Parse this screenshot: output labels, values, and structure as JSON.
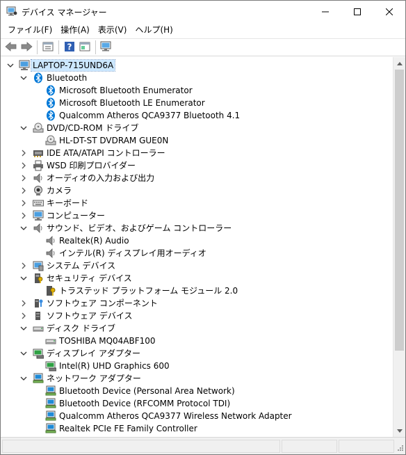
{
  "window": {
    "title": "デバイス マネージャー"
  },
  "menu": [
    {
      "label": "ファイル(F)"
    },
    {
      "label": "操作(A)"
    },
    {
      "label": "表示(V)"
    },
    {
      "label": "ヘルプ(H)"
    }
  ],
  "toolbar": {
    "buttons": [
      "back-icon",
      "forward-icon",
      "properties-icon",
      "help-icon",
      "view-icon",
      "scan-hardware-icon"
    ]
  },
  "tree": {
    "root": "LAPTOP-715UND6A",
    "nodes": [
      {
        "level": 1,
        "expanded": true,
        "icon": "bluetooth-icon",
        "label": "Bluetooth"
      },
      {
        "level": 2,
        "icon": "bluetooth-icon",
        "label": "Microsoft Bluetooth Enumerator"
      },
      {
        "level": 2,
        "icon": "bluetooth-icon",
        "label": "Microsoft Bluetooth LE Enumerator"
      },
      {
        "level": 2,
        "icon": "bluetooth-icon",
        "label": "Qualcomm Atheros QCA9377 Bluetooth 4.1"
      },
      {
        "level": 1,
        "expanded": true,
        "icon": "dvd-drive-icon",
        "label": "DVD/CD-ROM ドライブ"
      },
      {
        "level": 2,
        "icon": "dvd-drive-icon",
        "label": "HL-DT-ST DVDRAM GUE0N"
      },
      {
        "level": 1,
        "expanded": false,
        "icon": "ide-controller-icon",
        "label": "IDE ATA/ATAPI コントローラー"
      },
      {
        "level": 1,
        "expanded": false,
        "icon": "printer-icon",
        "label": "WSD 印刷プロバイダー"
      },
      {
        "level": 1,
        "expanded": false,
        "icon": "speaker-icon",
        "label": "オーディオの入力および出力"
      },
      {
        "level": 1,
        "expanded": false,
        "icon": "camera-icon",
        "label": "カメラ"
      },
      {
        "level": 1,
        "expanded": false,
        "icon": "keyboard-icon",
        "label": "キーボード"
      },
      {
        "level": 1,
        "expanded": false,
        "icon": "monitor-icon",
        "label": "コンピューター"
      },
      {
        "level": 1,
        "expanded": true,
        "icon": "speaker-icon",
        "label": "サウンド、ビデオ、およびゲーム コントローラー"
      },
      {
        "level": 2,
        "icon": "speaker-icon",
        "label": "Realtek(R) Audio"
      },
      {
        "level": 2,
        "icon": "speaker-icon",
        "label": "インテル(R) ディスプレイ用オーディオ"
      },
      {
        "level": 1,
        "expanded": false,
        "icon": "system-device-icon",
        "label": "システム デバイス"
      },
      {
        "level": 1,
        "expanded": true,
        "icon": "security-device-icon",
        "label": "セキュリティ デバイス"
      },
      {
        "level": 2,
        "icon": "tpm-icon",
        "label": "トラステッド プラットフォーム モジュール 2.0"
      },
      {
        "level": 1,
        "expanded": false,
        "icon": "software-component-icon",
        "label": "ソフトウェア コンポーネント"
      },
      {
        "level": 1,
        "expanded": false,
        "icon": "software-device-icon",
        "label": "ソフトウェア デバイス"
      },
      {
        "level": 1,
        "expanded": true,
        "icon": "disk-drive-icon",
        "label": "ディスク ドライブ"
      },
      {
        "level": 2,
        "icon": "disk-drive-icon",
        "label": "TOSHIBA MQ04ABF100"
      },
      {
        "level": 1,
        "expanded": true,
        "icon": "display-adapter-icon",
        "label": "ディスプレイ アダプター"
      },
      {
        "level": 2,
        "icon": "display-adapter-icon",
        "label": "Intel(R) UHD Graphics 600"
      },
      {
        "level": 1,
        "expanded": true,
        "icon": "network-adapter-icon",
        "label": "ネットワーク アダプター"
      },
      {
        "level": 2,
        "icon": "network-adapter-icon",
        "label": "Bluetooth Device (Personal Area Network)"
      },
      {
        "level": 2,
        "icon": "network-adapter-icon",
        "label": "Bluetooth Device (RFCOMM Protocol TDI)"
      },
      {
        "level": 2,
        "icon": "network-adapter-icon",
        "label": "Qualcomm Atheros QCA9377 Wireless Network Adapter"
      },
      {
        "level": 2,
        "icon": "network-adapter-icon",
        "label": "Realtek PCIe FE Family Controller"
      }
    ]
  },
  "colors": {
    "bluetooth": "#0078d7",
    "selection": "#cce8ff",
    "network": "#1f8ad6"
  }
}
